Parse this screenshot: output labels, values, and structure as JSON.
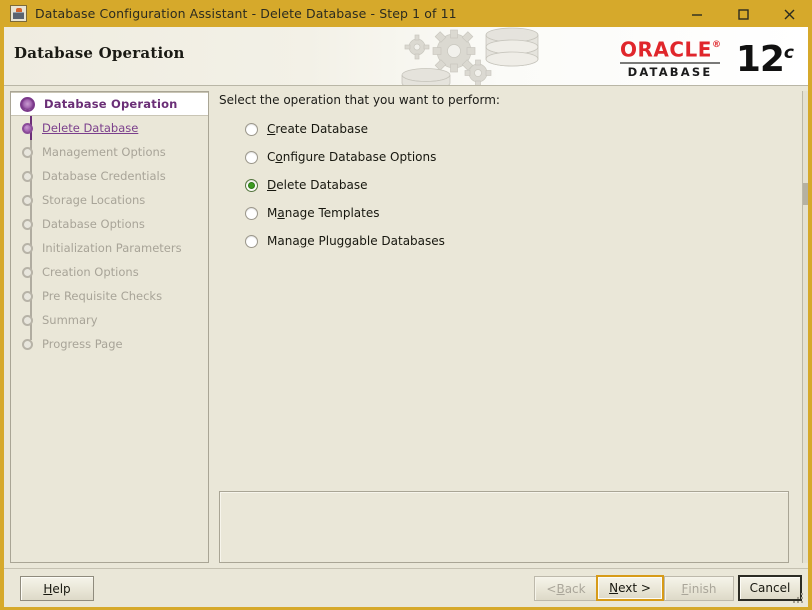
{
  "window": {
    "title": "Database Configuration Assistant - Delete Database - Step 1 of 11",
    "icon": "java-coffee-cup-icon",
    "minimize_label": "–",
    "maximize_label": "□",
    "close_label": "✕"
  },
  "header": {
    "page_title": "Database Operation",
    "brand": "ORACLE",
    "brand_trademark": "®",
    "brand_sub": "DATABASE",
    "version": "12",
    "version_suffix": "c",
    "brand_color": "#e0262b",
    "banner_gold": "#d6a92b"
  },
  "sidebar": {
    "steps": [
      {
        "label": "Database Operation",
        "state": "active"
      },
      {
        "label": "Delete Database",
        "state": "done"
      },
      {
        "label": "Management Options",
        "state": "pending"
      },
      {
        "label": "Database Credentials",
        "state": "pending"
      },
      {
        "label": "Storage Locations",
        "state": "pending"
      },
      {
        "label": "Database Options",
        "state": "pending"
      },
      {
        "label": "Initialization Parameters",
        "state": "pending"
      },
      {
        "label": "Creation Options",
        "state": "pending"
      },
      {
        "label": "Pre Requisite Checks",
        "state": "pending"
      },
      {
        "label": "Summary",
        "state": "pending"
      },
      {
        "label": "Progress Page",
        "state": "pending"
      }
    ],
    "active_color": "#6b2f77",
    "link_color": "#7b3f8c",
    "disabled_color": "#a8a498"
  },
  "main": {
    "prompt": "Select the operation that you want to perform:",
    "options": [
      {
        "label": "Create Database",
        "mnemonic": "C",
        "selected": false
      },
      {
        "label": "Configure Database Options",
        "mnemonic": "o",
        "selected": false
      },
      {
        "label": "Delete Database",
        "mnemonic": "D",
        "selected": true
      },
      {
        "label": "Manage Templates",
        "mnemonic": "a",
        "selected": false
      },
      {
        "label": "Manage Pluggable Databases",
        "mnemonic": "g",
        "selected": false
      }
    ],
    "selected_option": "Delete Database",
    "selected_radio_color": "#3d9c22",
    "message_panel_text": ""
  },
  "footer": {
    "help": {
      "label": "Help",
      "mnemonic": "H",
      "disabled": false,
      "focused": false,
      "default": false
    },
    "back": {
      "label": "< Back",
      "mnemonic": "B",
      "disabled": true,
      "focused": false,
      "default": false
    },
    "next": {
      "label": "Next >",
      "mnemonic": "N",
      "disabled": false,
      "focused": true,
      "default": false
    },
    "finish": {
      "label": "Finish",
      "mnemonic": "F",
      "disabled": true,
      "focused": false,
      "default": false
    },
    "cancel": {
      "label": "Cancel",
      "mnemonic": "",
      "disabled": false,
      "focused": false,
      "default": true
    }
  }
}
